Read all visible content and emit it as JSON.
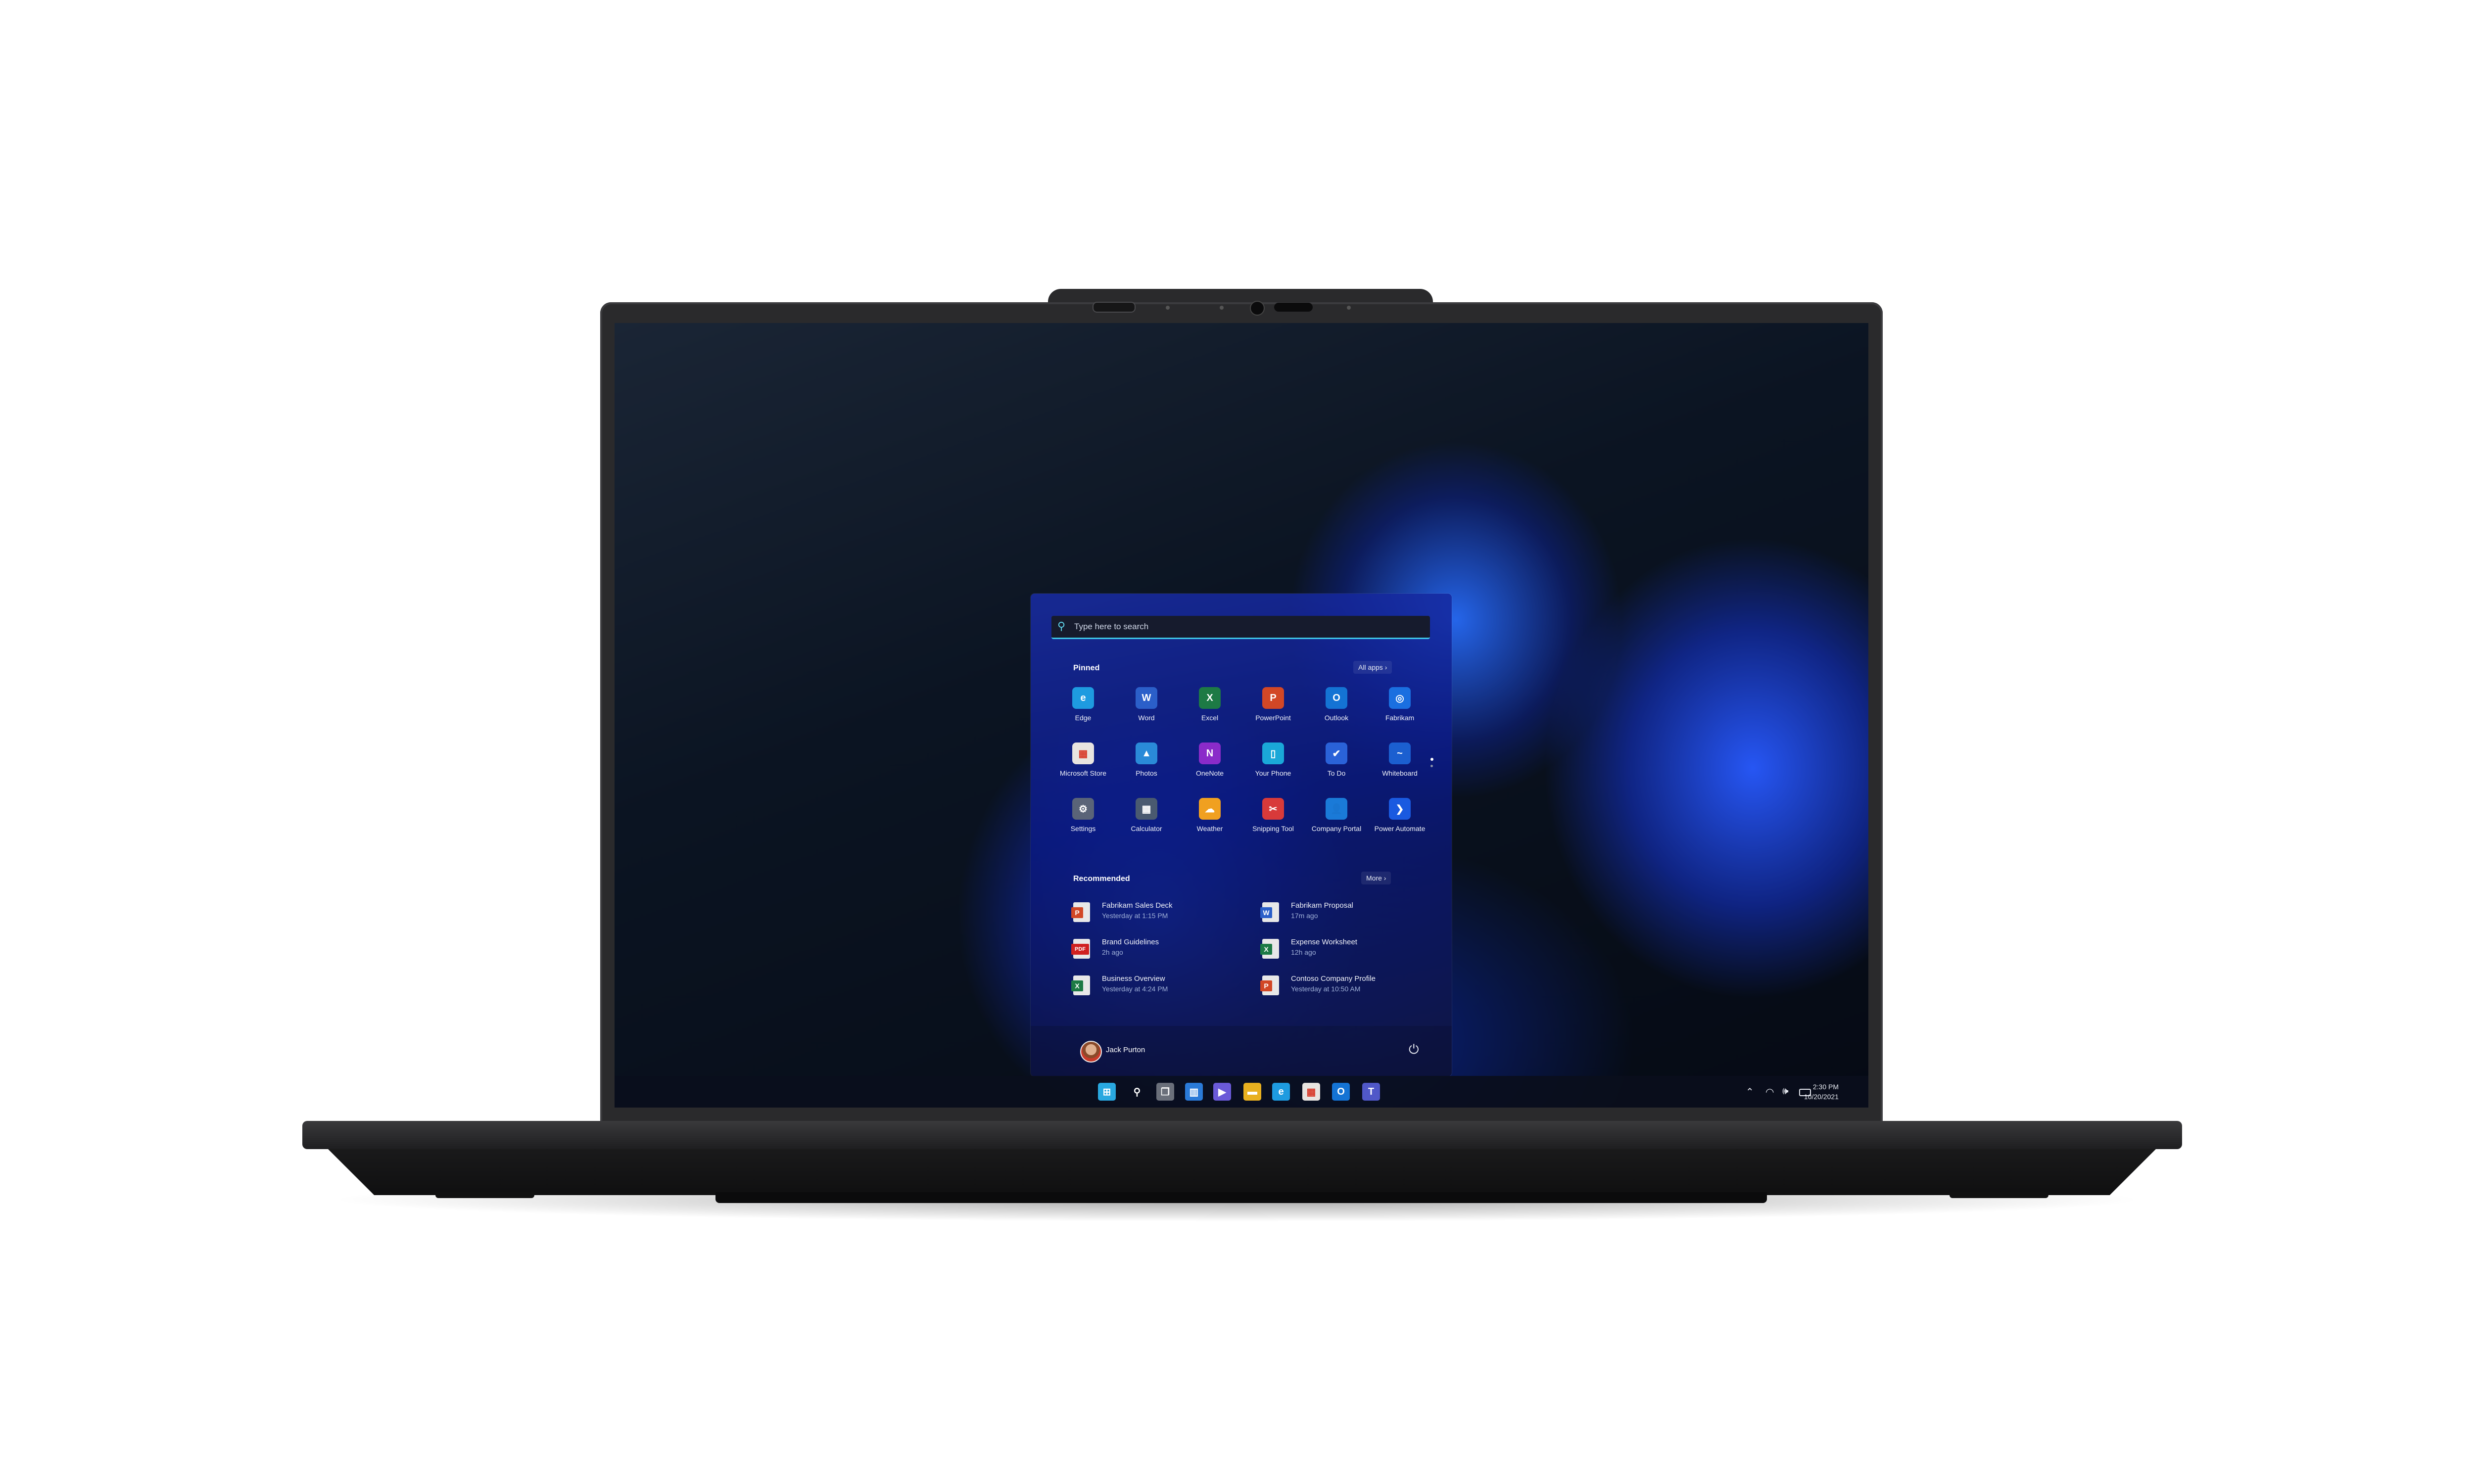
{
  "start_menu": {
    "search_placeholder": "Type here to search",
    "pinned_label": "Pinned",
    "all_apps_label": "All apps",
    "pinned": [
      {
        "label": "Edge",
        "icon": "edge-icon",
        "color": "#1e9be0",
        "glyph": "e"
      },
      {
        "label": "Word",
        "icon": "word-icon",
        "color": "#2b5fc9",
        "glyph": "W"
      },
      {
        "label": "Excel",
        "icon": "excel-icon",
        "color": "#1d7a45",
        "glyph": "X"
      },
      {
        "label": "PowerPoint",
        "icon": "powerpoint-icon",
        "color": "#d24726",
        "glyph": "P"
      },
      {
        "label": "Outlook",
        "icon": "outlook-icon",
        "color": "#1473d4",
        "glyph": "O"
      },
      {
        "label": "Fabrikam",
        "icon": "fabrikam-icon",
        "color": "#1a6fe0",
        "glyph": "◎"
      },
      {
        "label": "Microsoft Store",
        "icon": "store-icon",
        "color": "#e8e4e0",
        "glyph": "▦"
      },
      {
        "label": "Photos",
        "icon": "photos-icon",
        "color": "#2a8ad8",
        "glyph": "▲"
      },
      {
        "label": "OneNote",
        "icon": "onenote-icon",
        "color": "#8a2bc9",
        "glyph": "N"
      },
      {
        "label": "Your Phone",
        "icon": "phone-icon",
        "color": "#1aa8d8",
        "glyph": "▯"
      },
      {
        "label": "To Do",
        "icon": "todo-icon",
        "color": "#2a62d8",
        "glyph": "✔"
      },
      {
        "label": "Whiteboard",
        "icon": "whiteboard-icon",
        "color": "#1b5fd0",
        "glyph": "~"
      },
      {
        "label": "Settings",
        "icon": "settings-icon",
        "color": "#5a6478",
        "glyph": "⚙"
      },
      {
        "label": "Calculator",
        "icon": "calculator-icon",
        "color": "#4a5a70",
        "glyph": "▦"
      },
      {
        "label": "Weather",
        "icon": "weather-icon",
        "color": "#f0a020",
        "glyph": "☁"
      },
      {
        "label": "Snipping Tool",
        "icon": "snipping-tool-icon",
        "color": "#d83a3a",
        "glyph": "✂"
      },
      {
        "label": "Company Portal",
        "icon": "company-portal-icon",
        "color": "#1a7ad8",
        "glyph": "👤"
      },
      {
        "label": "Power Automate",
        "icon": "power-automate-icon",
        "color": "#1a5ae0",
        "glyph": "❯"
      }
    ],
    "recommended_label": "Recommended",
    "more_label": "More",
    "recommended": [
      {
        "title": "Fabrikam Sales Deck",
        "subtitle": "Yesterday at 1:15 PM",
        "icon": "powerpoint-file-icon",
        "color": "#d24726",
        "glyph": "P"
      },
      {
        "title": "Fabrikam Proposal",
        "subtitle": "17m ago",
        "icon": "word-file-icon",
        "color": "#2b5fc9",
        "glyph": "W"
      },
      {
        "title": "Brand Guidelines",
        "subtitle": "2h ago",
        "icon": "pdf-file-icon",
        "color": "#d02020",
        "glyph": "PDF"
      },
      {
        "title": "Expense Worksheet",
        "subtitle": "12h ago",
        "icon": "excel-file-icon",
        "color": "#1d7a45",
        "glyph": "X"
      },
      {
        "title": "Business Overview",
        "subtitle": "Yesterday at 4:24 PM",
        "icon": "excel-file-icon",
        "color": "#1d7a45",
        "glyph": "X"
      },
      {
        "title": "Contoso Company Profile",
        "subtitle": "Yesterday at 10:50 AM",
        "icon": "powerpoint-file-icon",
        "color": "#d24726",
        "glyph": "P"
      }
    ],
    "user_name": "Jack Purton"
  },
  "taskbar": {
    "icons": [
      {
        "name": "start-icon",
        "color": "#29a8e0",
        "glyph": "⊞"
      },
      {
        "name": "search-icon",
        "color": "transparent",
        "glyph": "⚲"
      },
      {
        "name": "task-view-icon",
        "color": "#6a6f7a",
        "glyph": "❐"
      },
      {
        "name": "widgets-icon",
        "color": "#2a7ad8",
        "glyph": "▥"
      },
      {
        "name": "chat-icon",
        "color": "#6a5ad8",
        "glyph": "▶"
      },
      {
        "name": "file-explorer-icon",
        "color": "#e8b020",
        "glyph": "▬"
      },
      {
        "name": "edge-icon",
        "color": "#1e9be0",
        "glyph": "e"
      },
      {
        "name": "store-icon",
        "color": "#e8e4e0",
        "glyph": "▦"
      },
      {
        "name": "outlook-icon",
        "color": "#1473d4",
        "glyph": "O"
      },
      {
        "name": "teams-icon",
        "color": "#5058c8",
        "glyph": "T"
      }
    ],
    "time": "2:30 PM",
    "date": "10/20/2021"
  }
}
